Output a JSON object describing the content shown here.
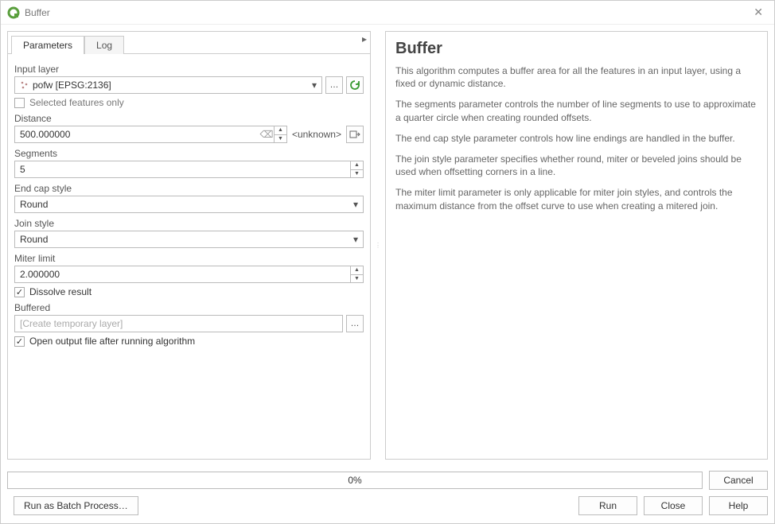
{
  "window": {
    "title": "Buffer"
  },
  "tabs": {
    "parameters": "Parameters",
    "log": "Log"
  },
  "labels": {
    "input_layer": "Input layer",
    "selected_only": "Selected features only",
    "distance": "Distance",
    "segments": "Segments",
    "end_cap": "End cap style",
    "join_style": "Join style",
    "miter_limit": "Miter limit",
    "dissolve": "Dissolve result",
    "buffered": "Buffered",
    "open_output": "Open output file after running algorithm"
  },
  "values": {
    "input_layer": "pofw [EPSG:2136]",
    "distance": "500.000000",
    "distance_unit": "<unknown>",
    "segments": "5",
    "end_cap": "Round",
    "join_style": "Round",
    "miter_limit": "2.000000",
    "buffered_placeholder": "[Create temporary layer]",
    "dissolve_checked": true,
    "open_output_checked": true,
    "selected_only_checked": false
  },
  "help": {
    "title": "Buffer",
    "p1": "This algorithm computes a buffer area for all the features in an input layer, using a fixed or dynamic distance.",
    "p2": "The segments parameter controls the number of line segments to use to approximate a quarter circle when creating rounded offsets.",
    "p3": "The end cap style parameter controls how line endings are handled in the buffer.",
    "p4": "The join style parameter specifies whether round, miter or beveled joins should be used when offsetting corners in a line.",
    "p5": "The miter limit parameter is only applicable for miter join styles, and controls the maximum distance from the offset curve to use when creating a mitered join."
  },
  "progress": {
    "text": "0%"
  },
  "buttons": {
    "cancel": "Cancel",
    "batch": "Run as Batch Process…",
    "run": "Run",
    "close": "Close",
    "help": "Help"
  }
}
